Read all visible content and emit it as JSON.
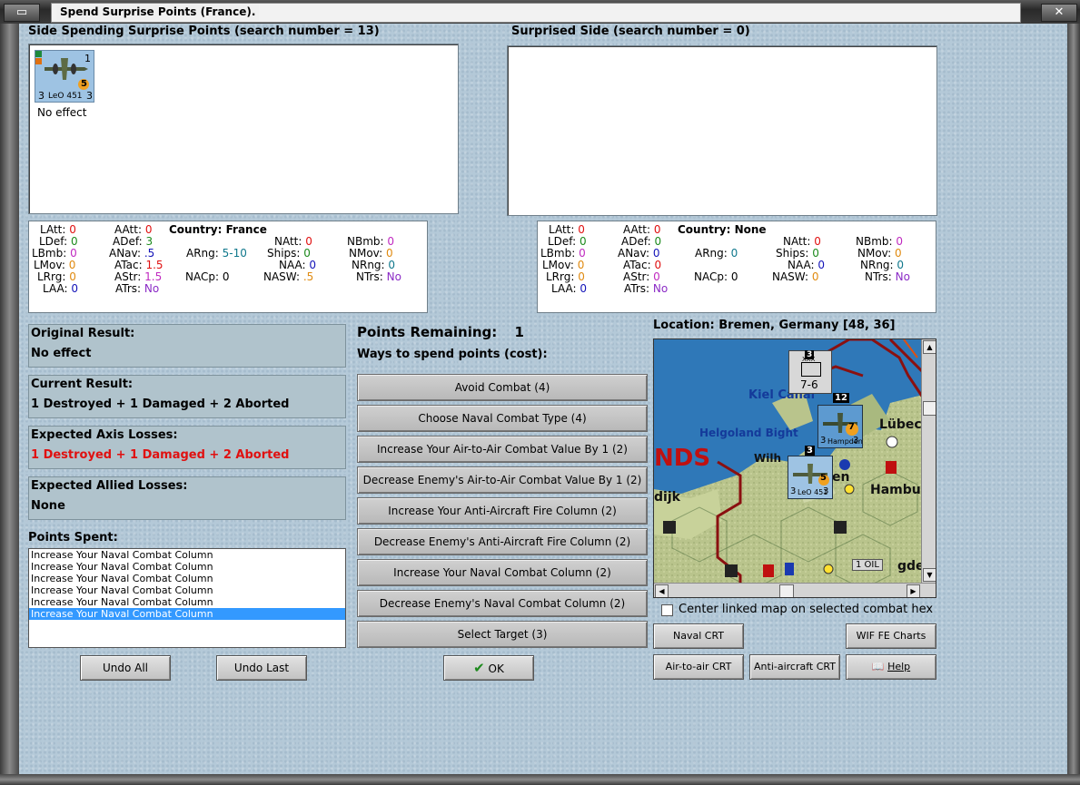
{
  "window": {
    "title": "Spend Surprise Points (France)."
  },
  "left_side": {
    "heading": "Side Spending Surprise Points (search number = 13)",
    "unit": {
      "name": "LeO 451",
      "left_value": "3",
      "right_value": "3",
      "top_value": "1",
      "badge": "5",
      "caption": "No effect"
    }
  },
  "right_side": {
    "heading": "Surprised Side (search number = 0)"
  },
  "left_stats": {
    "country_label": "Country: France",
    "latt": {
      "label": "LAtt:",
      "value": "0"
    },
    "ldef": {
      "label": "LDef:",
      "value": "0"
    },
    "lbmb": {
      "label": "LBmb:",
      "value": "0"
    },
    "lmov": {
      "label": "LMov:",
      "value": "0"
    },
    "lrrg": {
      "label": "LRrg:",
      "value": "0"
    },
    "laa": {
      "label": "LAA:",
      "value": "0"
    },
    "aatt": {
      "label": "AAtt:",
      "value": "0"
    },
    "adef": {
      "label": "ADef:",
      "value": "3"
    },
    "anav": {
      "label": "ANav:",
      "value": ".5"
    },
    "atac": {
      "label": "ATac:",
      "value": "1.5"
    },
    "astr": {
      "label": "AStr:",
      "value": "1.5"
    },
    "atrs": {
      "label": "ATrs:",
      "value": "No"
    },
    "arng": {
      "label": "ARng:",
      "value": "5-10"
    },
    "nacp": {
      "label": "NACp:",
      "value": "0"
    },
    "natt": {
      "label": "NAtt:",
      "value": "0"
    },
    "ships": {
      "label": "Ships:",
      "value": "0"
    },
    "naa": {
      "label": "NAA:",
      "value": "0"
    },
    "nasw": {
      "label": "NASW:",
      "value": ".5"
    },
    "nbmb": {
      "label": "NBmb:",
      "value": "0"
    },
    "nmov": {
      "label": "NMov:",
      "value": "0"
    },
    "nrng": {
      "label": "NRng:",
      "value": "0"
    },
    "ntrs": {
      "label": "NTrs:",
      "value": "No"
    }
  },
  "right_stats": {
    "country_label": "Country: None",
    "latt": {
      "label": "LAtt:",
      "value": "0"
    },
    "ldef": {
      "label": "LDef:",
      "value": "0"
    },
    "lbmb": {
      "label": "LBmb:",
      "value": "0"
    },
    "lmov": {
      "label": "LMov:",
      "value": "0"
    },
    "lrrg": {
      "label": "LRrg:",
      "value": "0"
    },
    "laa": {
      "label": "LAA:",
      "value": "0"
    },
    "aatt": {
      "label": "AAtt:",
      "value": "0"
    },
    "adef": {
      "label": "ADef:",
      "value": "0"
    },
    "anav": {
      "label": "ANav:",
      "value": "0"
    },
    "atac": {
      "label": "ATac:",
      "value": "0"
    },
    "astr": {
      "label": "AStr:",
      "value": "0"
    },
    "atrs": {
      "label": "ATrs:",
      "value": "No"
    },
    "arng": {
      "label": "ARng:",
      "value": "0"
    },
    "nacp": {
      "label": "NACp:",
      "value": "0"
    },
    "natt": {
      "label": "NAtt:",
      "value": "0"
    },
    "ships": {
      "label": "Ships:",
      "value": "0"
    },
    "naa": {
      "label": "NAA:",
      "value": "0"
    },
    "nasw": {
      "label": "NASW:",
      "value": "0"
    },
    "nbmb": {
      "label": "NBmb:",
      "value": "0"
    },
    "nmov": {
      "label": "NMov:",
      "value": "0"
    },
    "nrng": {
      "label": "NRng:",
      "value": "0"
    },
    "ntrs": {
      "label": "NTrs:",
      "value": "No"
    }
  },
  "results": {
    "original": {
      "title": "Original Result:",
      "value": "No effect"
    },
    "current": {
      "title": "Current Result:",
      "value": "1 Destroyed + 1 Damaged + 2 Aborted"
    },
    "axis": {
      "title": "Expected Axis Losses:",
      "value": "1 Destroyed + 1 Damaged + 2 Aborted"
    },
    "allied": {
      "title": "Expected Allied Losses:",
      "value": "None"
    }
  },
  "points_spent": {
    "title": "Points Spent:",
    "items": [
      "Increase Your Naval Combat Column",
      "Increase Your Naval Combat Column",
      "Increase Your Naval Combat Column",
      "Increase Your Naval Combat Column",
      "Increase Your Naval Combat Column",
      "Increase Your Naval Combat Column"
    ],
    "selected_index": 5
  },
  "undo_all": "Undo All",
  "undo_last": "Undo Last",
  "points_remaining": {
    "label": "Points Remaining:",
    "value": "1"
  },
  "ways_label": "Ways to spend points (cost):",
  "spend_options": [
    "Avoid Combat (4)",
    "Choose Naval Combat Type (4)",
    "Increase Your Air-to-Air Combat Value By 1 (2)",
    "Decrease Enemy's Air-to-Air Combat Value By 1 (2)",
    "Increase Your Anti-Aircraft Fire Column (2)",
    "Decrease Enemy's Anti-Aircraft Fire Column (2)",
    "Increase Your Naval Combat Column (2)",
    "Decrease Enemy's Naval Combat Column (2)",
    "Select Target (3)"
  ],
  "ok_label": "OK",
  "location": "Location: Bremen, Germany [48, 36]",
  "map": {
    "labels": {
      "kiel": "Kiel Canal",
      "helgoland": "Helgoland Bight",
      "lubeck": "Lübec",
      "wilh": "Wilh",
      "en": "en",
      "hamburg": "Hambu",
      "nds": "NDS",
      "dijk": "dijk",
      "oil": "1 OIL",
      "gde": "gde"
    },
    "units": {
      "hq": {
        "value": "7-6",
        "top": "3",
        "tag": "XXX"
      },
      "hampden": {
        "name": "Hampden",
        "top": "12",
        "badge": "7",
        "left": "3",
        "right": "3"
      },
      "leo": {
        "name": "LeO 451",
        "top": "3",
        "badge": "5",
        "left": "3",
        "right": "3"
      }
    }
  },
  "center_linked_label": "Center linked map on selected combat hex",
  "naval_crt": "Naval CRT",
  "wif_charts": "WIF FE Charts",
  "air_crt": "Air-to-air CRT",
  "aa_crt": "Anti-aircraft CRT",
  "help": "Help",
  "colors": {
    "background": "#b4c9d8",
    "red_loss": "#e01010",
    "selection": "#3399ff"
  }
}
